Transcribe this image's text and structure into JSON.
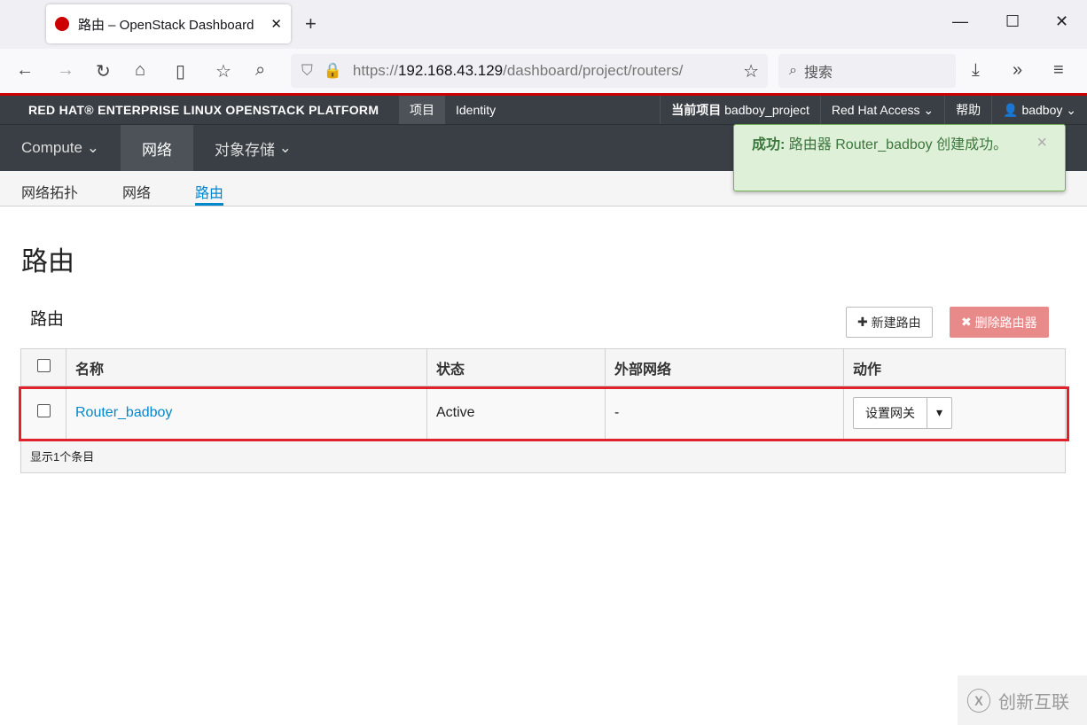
{
  "browser": {
    "tab_title": "路由 – OpenStack Dashboard",
    "url_prefix": "https://",
    "url_host": "192.168.43.129",
    "url_path": "/dashboard/project/routers/",
    "search_placeholder": "搜索"
  },
  "topbar": {
    "brand": "RED HAT® ENTERPRISE LINUX OPENSTACK PLATFORM",
    "tabs": [
      "项目",
      "Identity"
    ],
    "project_label": "当前项目",
    "project": "badboy_project",
    "access": "Red Hat Access",
    "help": "帮助",
    "user": "badboy"
  },
  "menu": [
    "Compute",
    "网络",
    "对象存储"
  ],
  "subnav": [
    "网络拓扑",
    "网络",
    "路由"
  ],
  "page": {
    "title": "路由",
    "table_title": "路由",
    "create_btn": "新建路由",
    "delete_btn": "删除路由器"
  },
  "table": {
    "headers": [
      "名称",
      "状态",
      "外部网络",
      "动作"
    ],
    "rows": [
      {
        "name": "Router_badboy",
        "status": "Active",
        "external": "-",
        "action": "设置网关"
      }
    ],
    "footer": "显示1个条目"
  },
  "toast": {
    "label": "成功:",
    "message": "路由器 Router_badboy 创建成功。"
  },
  "watermark": "创新互联"
}
